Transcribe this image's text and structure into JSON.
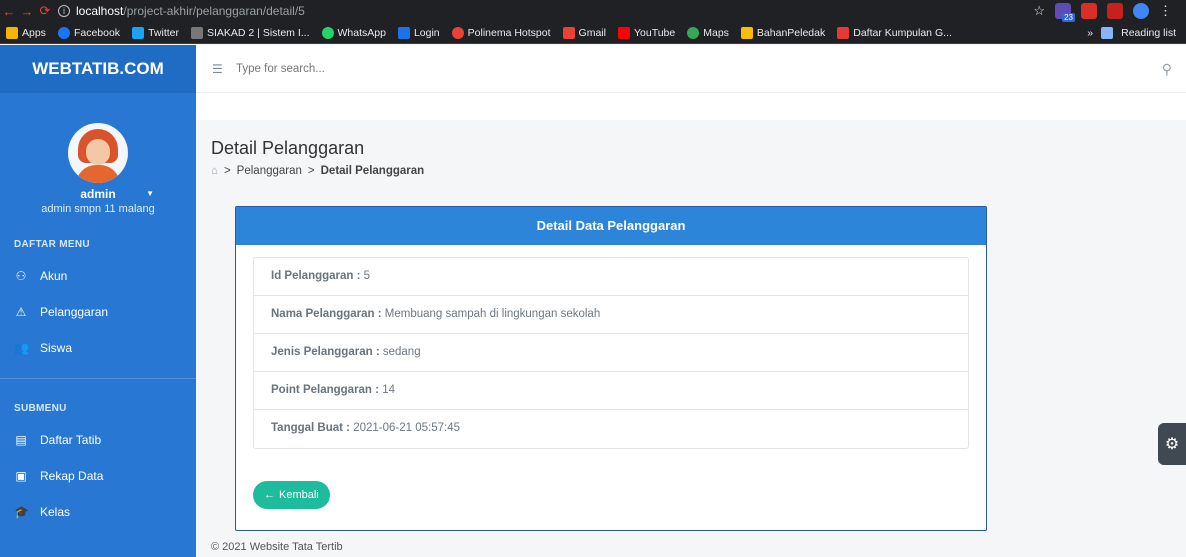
{
  "browser": {
    "url_host": "localhost",
    "url_path": "/project-akhir/pelanggaran/detail/5",
    "extension_badge": "23",
    "bookmarks": [
      {
        "label": "Apps",
        "color": "#f4b400"
      },
      {
        "label": "Facebook",
        "color": "#1877f2"
      },
      {
        "label": "Twitter",
        "color": "#1da1f2"
      },
      {
        "label": "SIAKAD 2 | Sistem I...",
        "color": "#777777"
      },
      {
        "label": "WhatsApp",
        "color": "#25d366"
      },
      {
        "label": "Login",
        "color": "#1a73e8"
      },
      {
        "label": "Polinema Hotspot",
        "color": "#ea4335"
      },
      {
        "label": "Gmail",
        "color": "#ea4335"
      },
      {
        "label": "YouTube",
        "color": "#ff0000"
      },
      {
        "label": "Maps",
        "color": "#34a853"
      },
      {
        "label": "BahanPeledak",
        "color": "#fbbc04"
      },
      {
        "label": "Daftar Kumpulan G...",
        "color": "#e53935"
      }
    ],
    "overflow": "»",
    "reading_list": "Reading list"
  },
  "sidebar": {
    "brand": "WEBTATIB.COM",
    "user_name": "admin",
    "user_sub": "admin smpn 11 malang",
    "menu_title": "DAFTAR MENU",
    "menu": [
      {
        "label": "Akun",
        "icon": "user-icon"
      },
      {
        "label": "Pelanggaran",
        "icon": "warning-icon"
      },
      {
        "label": "Siswa",
        "icon": "users-icon"
      }
    ],
    "submenu_title": "SUBMENU",
    "submenu": [
      {
        "label": "Daftar Tatib",
        "icon": "list-icon"
      },
      {
        "label": "Rekap Data",
        "icon": "save-icon"
      },
      {
        "label": "Kelas",
        "icon": "graduation-icon"
      }
    ]
  },
  "header": {
    "search_placeholder": "Type for search..."
  },
  "page": {
    "title": "Detail Pelanggaran",
    "breadcrumb": [
      "Pelanggaran",
      "Detail Pelanggaran"
    ],
    "card_title": "Detail Data Pelanggaran",
    "fields": [
      {
        "label": "Id Pelanggaran :",
        "value": "5"
      },
      {
        "label": "Nama Pelanggaran :",
        "value": "Membuang sampah di lingkungan sekolah"
      },
      {
        "label": "Jenis Pelanggaran :",
        "value": "sedang"
      },
      {
        "label": "Point Pelanggaran :",
        "value": "14"
      },
      {
        "label": "Tanggal Buat :",
        "value": "2021-06-21 05:57:45"
      }
    ],
    "back_button": "Kembali",
    "footer": "© 2021 Website Tata Tertib"
  }
}
